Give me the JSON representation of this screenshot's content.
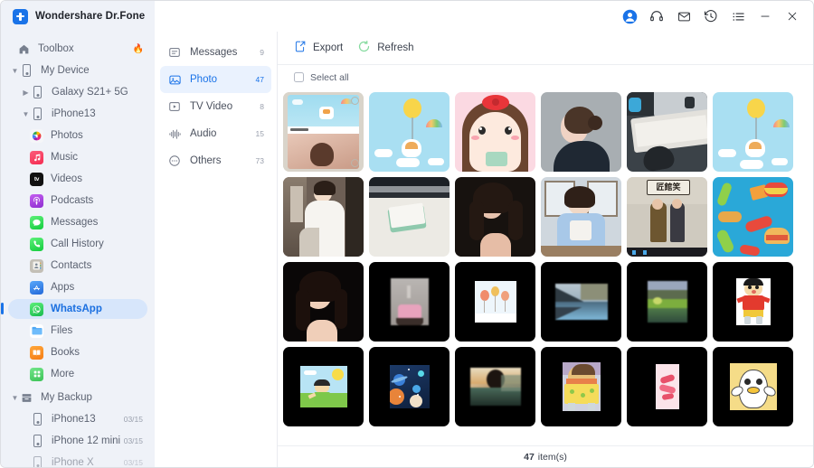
{
  "window": {
    "brand": "Wondershare Dr.Fone",
    "logo_icon": "plus-logo-icon",
    "controls": [
      {
        "name": "account-icon",
        "label": "Account"
      },
      {
        "name": "support-headset-icon",
        "label": "Support"
      },
      {
        "name": "mail-icon",
        "label": "Mail"
      },
      {
        "name": "history-icon",
        "label": "History"
      },
      {
        "name": "menu-list-icon",
        "label": "Menu"
      },
      {
        "name": "minimize-button",
        "label": "Minimize"
      },
      {
        "name": "close-button",
        "label": "Close"
      }
    ]
  },
  "sidebar": {
    "items": [
      {
        "label": "Toolbox",
        "icon": "home-icon",
        "badge": "flame-icon",
        "level": 0,
        "selected": false,
        "chevron": ""
      },
      {
        "label": "My Device",
        "icon": "device-icon",
        "level": 1,
        "selected": false,
        "chevron": "v"
      },
      {
        "label": "Galaxy S21+ 5G",
        "icon": "device-icon",
        "level": 2,
        "selected": false,
        "chevron": ">"
      },
      {
        "label": "iPhone13",
        "icon": "device-icon",
        "level": 2,
        "selected": false,
        "chevron": "v"
      },
      {
        "label": "Photos",
        "icon": "photos-icon",
        "level": 3,
        "selected": false,
        "color": "#f4f5f7"
      },
      {
        "label": "Music",
        "icon": "music-icon",
        "level": 3,
        "selected": false,
        "color": "#fb3b5c"
      },
      {
        "label": "Videos",
        "icon": "appletv-icon",
        "level": 3,
        "selected": false,
        "color": "#111111"
      },
      {
        "label": "Podcasts",
        "icon": "podcasts-icon",
        "level": 3,
        "selected": false,
        "color": "#a33ae0"
      },
      {
        "label": "Messages",
        "icon": "messages-icon",
        "level": 3,
        "selected": false,
        "color": "#2ecc50"
      },
      {
        "label": "Call History",
        "icon": "phone-icon",
        "level": 3,
        "selected": false,
        "color": "#2ecc50"
      },
      {
        "label": "Contacts",
        "icon": "contacts-icon",
        "level": 3,
        "selected": false,
        "color": "#b6b3ac"
      },
      {
        "label": "Apps",
        "icon": "appstore-icon",
        "level": 3,
        "selected": false,
        "color": "#3d8bfd"
      },
      {
        "label": "WhatsApp",
        "icon": "whatsapp-icon",
        "level": 3,
        "selected": true,
        "color": "#25d366"
      },
      {
        "label": "Files",
        "icon": "folder-icon",
        "level": 3,
        "selected": false,
        "color": "#4fa8f5"
      },
      {
        "label": "Books",
        "icon": "books-icon",
        "level": 3,
        "selected": false,
        "color": "#ff8a1e"
      },
      {
        "label": "More",
        "icon": "more-grid-icon",
        "level": 3,
        "selected": false,
        "color": "#4ecf6a"
      },
      {
        "label": "My Backup",
        "icon": "backup-icon",
        "level": 1,
        "selected": false,
        "chevron": "v"
      },
      {
        "label": "iPhone13",
        "icon": "device-icon",
        "level": 2,
        "selected": false,
        "date": "03/15"
      },
      {
        "label": "iPhone 12 mini",
        "icon": "device-icon",
        "level": 2,
        "selected": false,
        "date": "03/15"
      },
      {
        "label": "iPhone X",
        "icon": "device-icon",
        "level": 2,
        "selected": false,
        "date": "03/15"
      }
    ]
  },
  "categories": {
    "items": [
      {
        "label": "Messages",
        "count": "9",
        "icon": "message-square-icon",
        "active": false
      },
      {
        "label": "Photo",
        "count": "47",
        "icon": "photo-icon",
        "active": true
      },
      {
        "label": "TV Video",
        "count": "8",
        "icon": "video-play-icon",
        "active": false
      },
      {
        "label": "Audio",
        "count": "15",
        "icon": "audio-wave-icon",
        "active": false
      },
      {
        "label": "Others",
        "count": "73",
        "icon": "dots-circle-icon",
        "active": false
      }
    ]
  },
  "toolbar": {
    "export_label": "Export",
    "export_icon": "export-icon",
    "refresh_label": "Refresh",
    "refresh_icon": "refresh-icon",
    "select_all_label": "Select all"
  },
  "status": {
    "count": "47",
    "unit": "item(s)"
  },
  "colors": {
    "accent": "#1a73e8",
    "sidebar_bg": "#eff2f8",
    "selected_pill": "#d7e6fb",
    "refresh_green": "#87dba0"
  },
  "gallery": {
    "thumbnails": [
      {
        "name": "chat-screenshot-corgi",
        "kind": "light"
      },
      {
        "name": "corgi-balloon-illustration",
        "kind": "light"
      },
      {
        "name": "cartoon-girl-red-bow",
        "kind": "light"
      },
      {
        "name": "woman-profile-gray-wall",
        "kind": "light"
      },
      {
        "name": "desk-keyboard-mouse-photo",
        "kind": "light"
      },
      {
        "name": "corgi-balloon-illustration-2",
        "kind": "light"
      },
      {
        "name": "woman-white-dress-corridor",
        "kind": "light"
      },
      {
        "name": "notebook-on-desk-photo",
        "kind": "light"
      },
      {
        "name": "woman-dark-portrait",
        "kind": "light"
      },
      {
        "name": "woman-blue-top-window",
        "kind": "light"
      },
      {
        "name": "tv-drama-poster",
        "kind": "light"
      },
      {
        "name": "food-pattern-illustration",
        "kind": "light"
      },
      {
        "name": "woman-dark-portrait-2",
        "kind": "dark"
      },
      {
        "name": "pink-cake-photo",
        "kind": "dark"
      },
      {
        "name": "balloons-sky-illustration",
        "kind": "dark"
      },
      {
        "name": "lake-reflection-photo",
        "kind": "dark"
      },
      {
        "name": "green-mountain-lake-photo",
        "kind": "dark"
      },
      {
        "name": "cartoon-boy-red-shirt",
        "kind": "dark"
      },
      {
        "name": "cartoon-boy-grass-sun",
        "kind": "dark"
      },
      {
        "name": "space-planets-illustration",
        "kind": "dark"
      },
      {
        "name": "sunset-landscape-photo",
        "kind": "dark"
      },
      {
        "name": "cartoon-sandwich-character",
        "kind": "dark"
      },
      {
        "name": "pink-candy-illustration",
        "kind": "dark"
      },
      {
        "name": "cartoon-duck-yellow-bg",
        "kind": "dark"
      }
    ]
  }
}
